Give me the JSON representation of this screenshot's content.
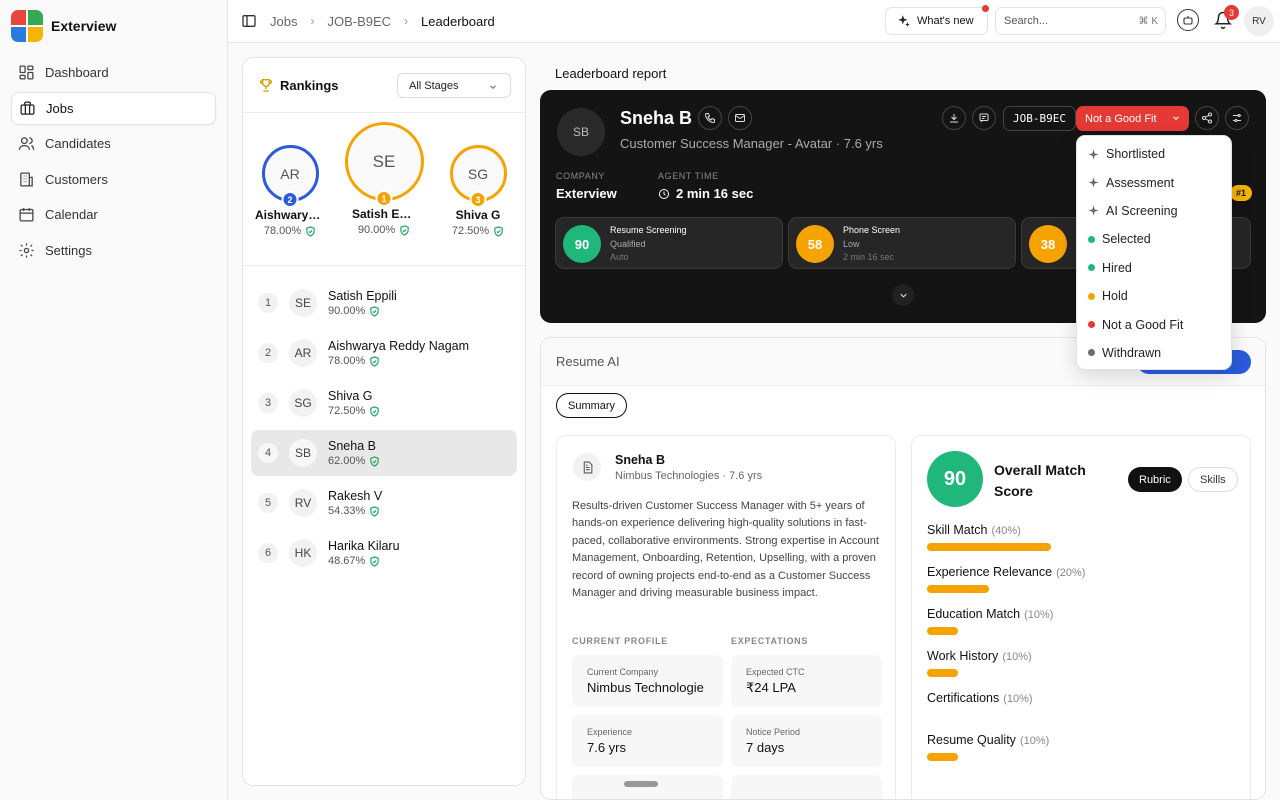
{
  "app": {
    "name": "Exterview"
  },
  "sidebar": {
    "items": [
      {
        "label": "Dashboard",
        "icon": "dashboard-icon"
      },
      {
        "label": "Jobs",
        "icon": "briefcase-icon",
        "active": true
      },
      {
        "label": "Candidates",
        "icon": "users-icon"
      },
      {
        "label": "Customers",
        "icon": "building-icon"
      },
      {
        "label": "Calendar",
        "icon": "calendar-icon"
      },
      {
        "label": "Settings",
        "icon": "gear-icon"
      }
    ]
  },
  "topbar": {
    "breadcrumbs": [
      "Jobs",
      "JOB-B9EC",
      "Leaderboard"
    ],
    "whats_new": "What's new",
    "search_placeholder": "Search...",
    "search_shortcut": "⌘ K",
    "notif_count": "3",
    "user_initials": "RV"
  },
  "rankings": {
    "title": "Rankings",
    "stage_filter": "All Stages",
    "podium": [
      {
        "initials": "AR",
        "rank": "2",
        "name": "Aishwarya Reddy Nagam",
        "score": "78.00%",
        "color": "#2a5bdc"
      },
      {
        "initials": "SE",
        "rank": "1",
        "name": "Satish Eppili",
        "score": "90.00%",
        "color": "#f5a300"
      },
      {
        "initials": "SG",
        "rank": "3",
        "name": "Shiva G",
        "score": "72.50%",
        "color": "#f5a300"
      }
    ],
    "list": [
      {
        "rank": "1",
        "initials": "SE",
        "name": "Satish Eppili",
        "score": "90.00%"
      },
      {
        "rank": "2",
        "initials": "AR",
        "name": "Aishwarya Reddy Nagam",
        "score": "78.00%"
      },
      {
        "rank": "3",
        "initials": "SG",
        "name": "Shiva G",
        "score": "72.50%"
      },
      {
        "rank": "4",
        "initials": "SB",
        "name": "Sneha B",
        "score": "62.00%",
        "active": true
      },
      {
        "rank": "5",
        "initials": "RV",
        "name": "Rakesh V",
        "score": "54.33%"
      },
      {
        "rank": "6",
        "initials": "HK",
        "name": "Harika Kilaru",
        "score": "48.67%"
      }
    ]
  },
  "report": {
    "title": "Leaderboard report",
    "candidate": {
      "initials": "SB",
      "name": "Sneha B",
      "subtitle": "Customer Success Manager - Avatar · 7.6 yrs",
      "company_label": "COMPANY",
      "company": "Exterview",
      "agent_time_label": "AGENT TIME",
      "agent_time": "2 min 16 sec",
      "job_id": "JOB-B9EC",
      "status": "Not a Good Fit",
      "rank_tag": "#1"
    },
    "stages": [
      {
        "score": "90",
        "title": "Resume Screening",
        "sub": "Qualified",
        "sub2": "Auto",
        "color": "#1fb77a"
      },
      {
        "score": "58",
        "title": "Phone Screen",
        "sub": "Low",
        "sub2": "2 min 16 sec",
        "color": "#f5a300"
      },
      {
        "score": "38",
        "title": "",
        "sub": "",
        "sub2": "",
        "color": "#f5a300"
      }
    ]
  },
  "status_menu": {
    "items": [
      {
        "label": "Shortlisted",
        "icon": "sparkle-icon"
      },
      {
        "label": "Assessment",
        "icon": "sparkle-icon"
      },
      {
        "label": "AI Screening",
        "icon": "sparkle-icon"
      },
      {
        "label": "Selected",
        "dot": "#1fb77a"
      },
      {
        "label": "Hired",
        "dot": "#1fb77a"
      },
      {
        "label": "Hold",
        "dot": "#f5a300"
      },
      {
        "label": "Not a Good Fit",
        "dot": "#e53935"
      },
      {
        "label": "Withdrawn",
        "dot": "#666a7a"
      }
    ]
  },
  "resume_ai": {
    "title": "Resume AI",
    "tab": "Summary",
    "profile": {
      "name": "Sneha B",
      "sub": "Nimbus Technologies · 7.6 yrs",
      "summary": "Results-driven Customer Success Manager with 5+ years of hands-on experience delivering high-quality solutions in fast-paced, collaborative environments. Strong expertise in Account Management, Onboarding, Retention, Upselling, with a proven record of owning projects end-to-end as a Customer Success Manager and driving measurable business impact.",
      "current_profile_label": "CURRENT PROFILE",
      "expectations_label": "EXPECTATIONS",
      "fields": [
        {
          "label": "Current Company",
          "value": "Nimbus Technologie"
        },
        {
          "label": "Expected CTC",
          "value": "₹24 LPA"
        },
        {
          "label": "Experience",
          "value": "7.6 yrs"
        },
        {
          "label": "Notice Period",
          "value": "7 days"
        }
      ]
    },
    "score": {
      "value": "90",
      "title": "Overall Match Score",
      "tabs": [
        "Rubric",
        "Skills"
      ],
      "criteria": [
        {
          "name": "Skill Match",
          "weight": "(40%)",
          "fill": 0.4
        },
        {
          "name": "Experience Relevance",
          "weight": "(20%)",
          "fill": 0.2
        },
        {
          "name": "Education Match",
          "weight": "(10%)",
          "fill": 0.1
        },
        {
          "name": "Work History",
          "weight": "(10%)",
          "fill": 0.1
        },
        {
          "name": "Certifications",
          "weight": "(10%)",
          "fill": 0
        },
        {
          "name": "Resume Quality",
          "weight": "(10%)",
          "fill": 0.1
        }
      ]
    }
  }
}
